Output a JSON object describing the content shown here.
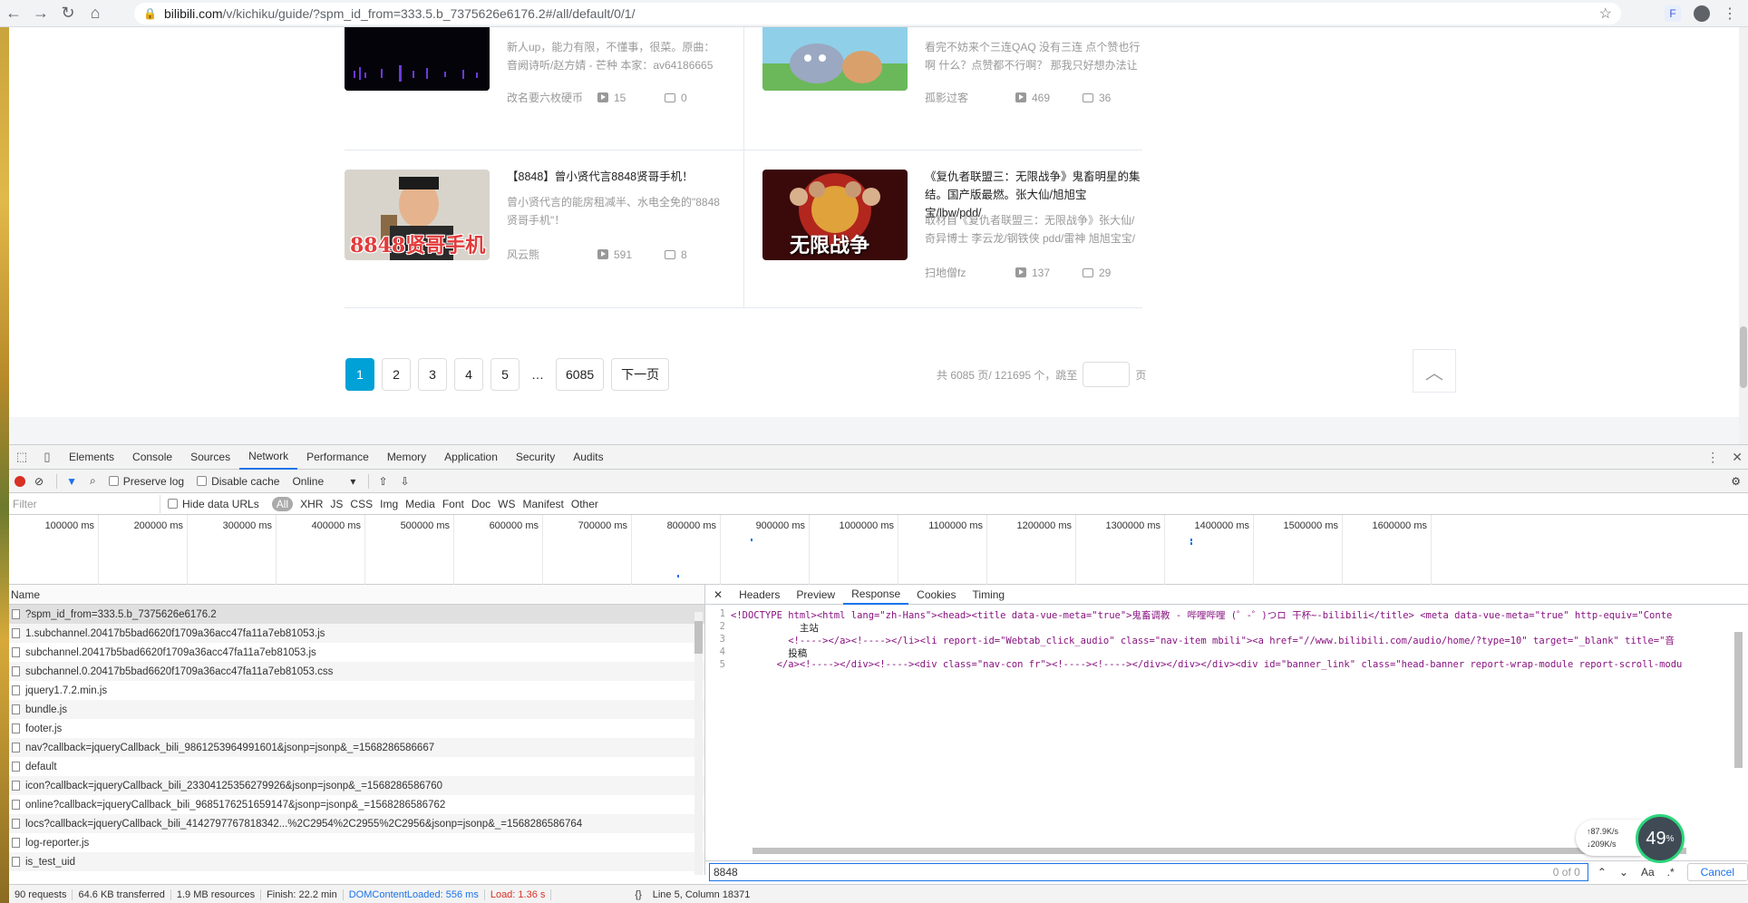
{
  "browser": {
    "url_host": "bilibili.com",
    "url_path": "/v/kichiku/guide/?spm_id_from=333.5.b_7375626e6176.2#/all/default/0/1/",
    "ext_label": "F"
  },
  "videos": [
    {
      "title": "",
      "desc": "新人up，能力有限，不懂事，很菜。原曲：音阙诗听/赵方婧 - 芒种 本家：av64186665",
      "author": "改名要六枚硬币",
      "plays": "15",
      "danmaku": "0"
    },
    {
      "title": "",
      "desc": "看完不妨来个三连QAQ 没有三连 点个赞也行啊 什么？点赞都不行啊？ 那我只好想办法让",
      "author": "孤影过客",
      "plays": "469",
      "danmaku": "36"
    },
    {
      "title": "【8848】曾小贤代言8848贤哥手机！",
      "desc": "曾小贤代言的能房租减半、水电全免的\"8848贤哥手机\"！",
      "author": "风云熊",
      "plays": "591",
      "danmaku": "8",
      "thumb_text": "8848贤哥手机"
    },
    {
      "title": "《复仇者联盟三：无限战争》鬼畜明星的集结。国产版最燃。张大仙/旭旭宝宝/lbw/pdd/",
      "desc": "取材自《复仇者联盟三：无限战争》张大仙/奇异博士 李云龙/钢铁侠 pdd/雷神 旭旭宝宝/",
      "author": "扫地僧fz",
      "plays": "137",
      "danmaku": "29",
      "thumb_text": "无限战争"
    }
  ],
  "pager": {
    "pages": [
      "1",
      "2",
      "3",
      "4",
      "5"
    ],
    "dots": "…",
    "last": "6085",
    "next": "下一页",
    "summary": "共 6085 页/ 121695 个，跳至",
    "page_unit": "页"
  },
  "devtools": {
    "tabs": [
      "Elements",
      "Console",
      "Sources",
      "Network",
      "Performance",
      "Memory",
      "Application",
      "Security",
      "Audits"
    ],
    "active_tab": "Network",
    "preserve_log": "Preserve log",
    "disable_cache": "Disable cache",
    "throttle": "Online",
    "filter_placeholder": "Filter",
    "hide_data_urls": "Hide data URLs",
    "filter_types": [
      "All",
      "XHR",
      "JS",
      "CSS",
      "Img",
      "Media",
      "Font",
      "Doc",
      "WS",
      "Manifest",
      "Other"
    ],
    "timeline_ticks": [
      "100000 ms",
      "200000 ms",
      "300000 ms",
      "400000 ms",
      "500000 ms",
      "600000 ms",
      "700000 ms",
      "800000 ms",
      "900000 ms",
      "1000000 ms",
      "1100000 ms",
      "1200000 ms",
      "1300000 ms",
      "1400000 ms",
      "1500000 ms",
      "1600000 ms"
    ],
    "name_header": "Name",
    "requests": [
      "?spm_id_from=333.5.b_7375626e6176.2",
      "1.subchannel.20417b5bad6620f1709a36acc47fa11a7eb81053.js",
      "subchannel.20417b5bad6620f1709a36acc47fa11a7eb81053.js",
      "subchannel.0.20417b5bad6620f1709a36acc47fa11a7eb81053.css",
      "jquery1.7.2.min.js",
      "bundle.js",
      "footer.js",
      "nav?callback=jqueryCallback_bili_9861253964991601&jsonp=jsonp&_=1568286586667",
      "default",
      "icon?callback=jqueryCallback_bili_23304125356279926&jsonp=jsonp&_=1568286586760",
      "online?callback=jqueryCallback_bili_9685176251659147&jsonp=jsonp&_=1568286586762",
      "locs?callback=jqueryCallback_bili_4142797767818342...%2C2954%2C2955%2C2956&jsonp=jsonp&_=1568286586764",
      "log-reporter.js",
      "is_test_uid"
    ],
    "resp_tabs": [
      "Headers",
      "Preview",
      "Response",
      "Cookies",
      "Timing"
    ],
    "resp_active": "Response",
    "code_lines": [
      "<!DOCTYPE html><html lang=\"zh-Hans\"><head><title data-vue-meta=\"true\">鬼畜调教 - 哔哩哔哩 (゜-゜)つロ 干杯~-bilibili</title> <meta data-vue-meta=\"true\" http-equiv=\"Conte",
      "            主站",
      "          <!----></a><!----></li><li report-id=\"Webtab_click_audio\" class=\"nav-item mbili\"><a href=\"//www.bilibili.com/audio/home/?type=10\" target=\"_blank\" title=\"音",
      "          投稿",
      "        </a><!----></div><!----><div class=\"nav-con fr\"><!----><!----></div></div></div><div id=\"banner_link\" class=\"head-banner report-wrap-module report-scroll-modu"
    ],
    "search_value": "8848",
    "search_count": "0 of 0",
    "aa": "Aa",
    "regex": ".*",
    "cancel": "Cancel",
    "status": {
      "requests": "90 requests",
      "transferred": "64.6 KB transferred",
      "resources": "1.9 MB resources",
      "finish": "Finish: 22.2 min",
      "dom": "DOMContentLoaded: 556 ms",
      "load": "Load: 1.36 s"
    },
    "cursor_pos": "Line 5, Column 18371"
  },
  "speed_widget": {
    "up": "87.9K/s",
    "down": "209K/s",
    "percent": "49",
    "percent_unit": "%"
  }
}
